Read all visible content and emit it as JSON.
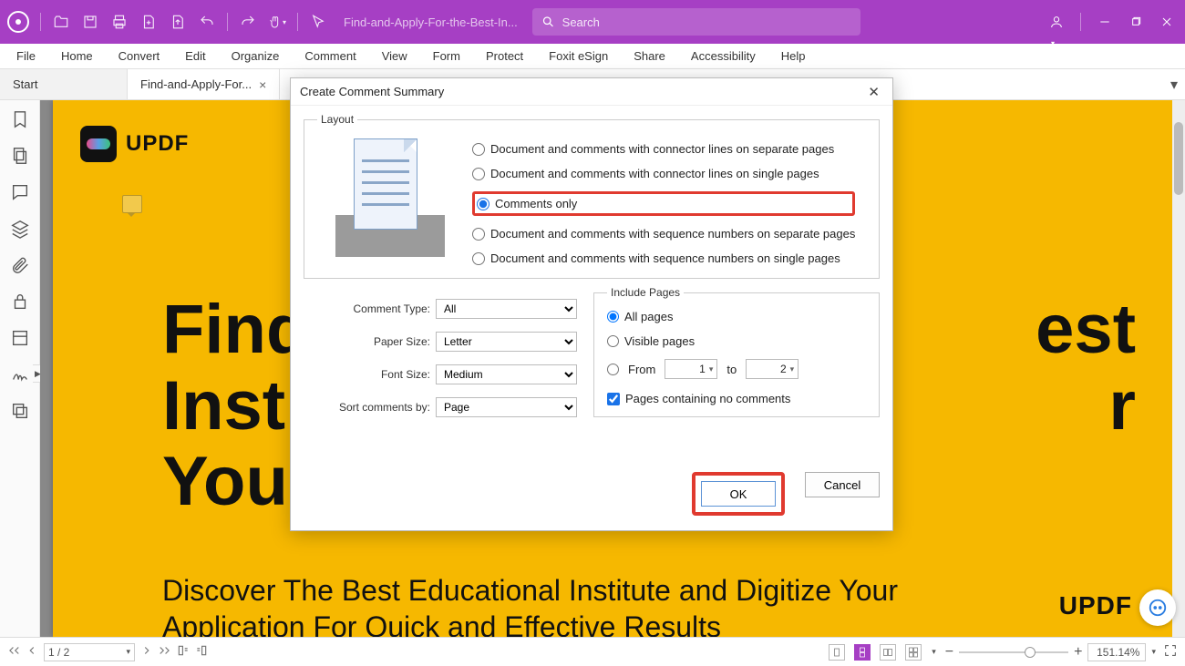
{
  "titlebar": {
    "doc_title": "Find-and-Apply-For-the-Best-In...",
    "search_placeholder": "Search"
  },
  "menu": [
    "File",
    "Home",
    "Convert",
    "Edit",
    "Organize",
    "Comment",
    "View",
    "Form",
    "Protect",
    "Foxit eSign",
    "Share",
    "Accessibility",
    "Help"
  ],
  "tabs": {
    "start": "Start",
    "active": "Find-and-Apply-For..."
  },
  "page_content": {
    "logo_text": "UPDF",
    "heading": "Find\nInstit\nYour",
    "heading_right": "est\nr",
    "subheading": "Discover The Best Educational Institute and Digitize Your Application For Quick and Effective Results",
    "brand": "UPDF"
  },
  "dialog": {
    "title": "Create Comment Summary",
    "layout_legend": "Layout",
    "layout_options": [
      "Document and comments with connector lines on separate pages",
      "Document and comments with connector lines on single pages",
      "Comments only",
      "Document and comments with sequence numbers on separate pages",
      "Document and comments with sequence numbers on single pages"
    ],
    "layout_selected_index": 2,
    "fields": {
      "comment_type_label": "Comment Type:",
      "comment_type_value": "All",
      "paper_size_label": "Paper Size:",
      "paper_size_value": "Letter",
      "font_size_label": "Font Size:",
      "font_size_value": "Medium",
      "sort_label": "Sort comments by:",
      "sort_value": "Page"
    },
    "include": {
      "legend": "Include Pages",
      "all_pages": "All pages",
      "visible_pages": "Visible pages",
      "from_label": "From",
      "from_value": "1",
      "to_label": "to",
      "to_value": "2",
      "no_comments_label": "Pages containing no comments",
      "selected": "all",
      "no_comments_checked": true
    },
    "ok": "OK",
    "cancel": "Cancel"
  },
  "statusbar": {
    "page": "1 / 2",
    "zoom": "151.14%"
  }
}
